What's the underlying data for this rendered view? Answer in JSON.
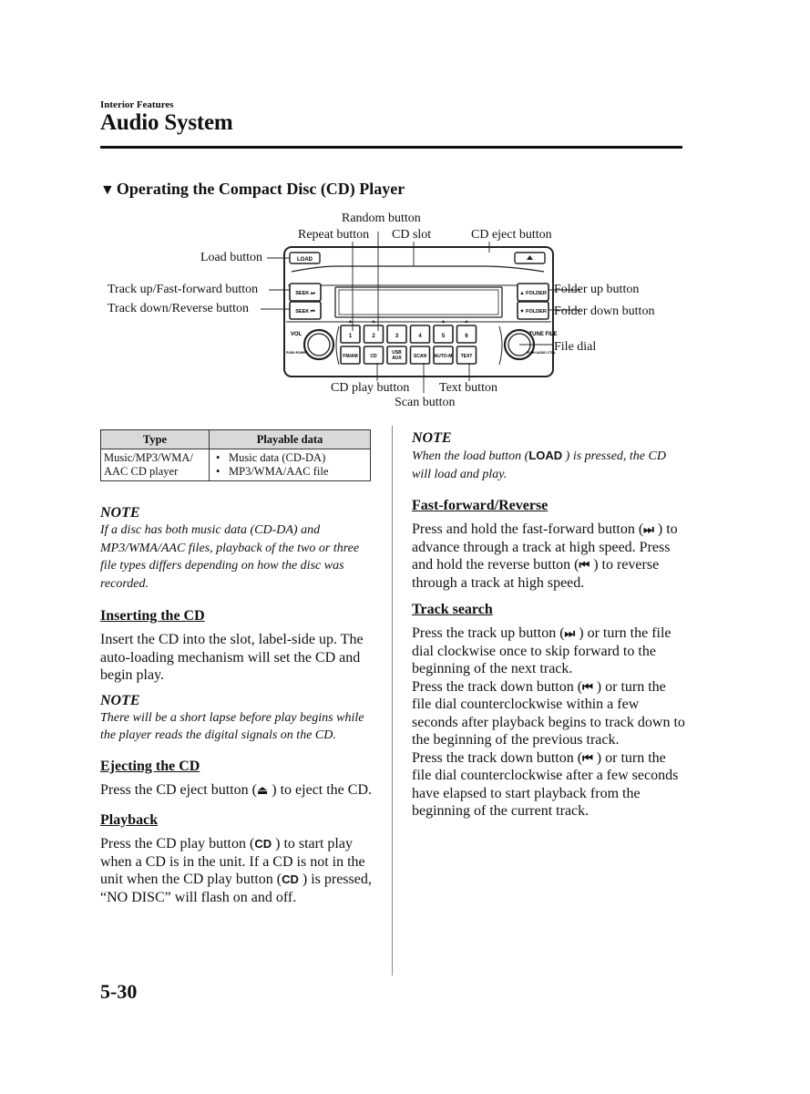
{
  "header": {
    "section_label": "Interior Features",
    "page_title": "Audio System"
  },
  "subsection": {
    "marker": "▼",
    "title": "Operating the Compact Disc (CD) Player"
  },
  "diagram": {
    "callouts": {
      "random": "Random button",
      "repeat": "Repeat button",
      "cd_slot": "CD slot",
      "cd_eject": "CD eject button",
      "load": "Load button",
      "track_up": "Track up/Fast-forward button",
      "track_down": "Track down/Reverse button",
      "folder_up": "Folder up button",
      "folder_down": "Folder down button",
      "file_dial": "File dial",
      "cd_play": "CD play button",
      "text": "Text button",
      "scan": "Scan button"
    },
    "panel_labels": {
      "load": "LOAD",
      "eject_icon": "▲",
      "seek_up": "SEEK ⏭",
      "seek_down": "SEEK ⏮",
      "folder_up": "▲ FOLDER",
      "folder_down": "▼ FOLDER",
      "vol": "VOL",
      "push_power": "PUSH POWER",
      "tune_file": "TUNE FILE",
      "push_audio_ctrl": "PUSH AUDIO CTRL",
      "presets": [
        "1",
        "2",
        "3",
        "4",
        "5",
        "6"
      ],
      "bottom_buttons": [
        "FM/AM",
        "CD",
        "USB AUX",
        "SCAN",
        "AUTO-M",
        "TEXT"
      ]
    }
  },
  "table": {
    "headers": [
      "Type",
      "Playable data"
    ],
    "rows": [
      {
        "type": "Music/MP3/WMA/ AAC CD player",
        "data": [
          "Music data (CD-DA)",
          "MP3/WMA/AAC file"
        ]
      }
    ]
  },
  "left_column": {
    "note1": {
      "heading": "NOTE",
      "text": "If a disc has both music data (CD-DA) and MP3/WMA/AAC files, playback of the two or three file types differs depending on how the disc was recorded."
    },
    "inserting": {
      "heading": "Inserting the CD",
      "text": "Insert the CD into the slot, label-side up. The auto-loading mechanism will set the CD and begin play."
    },
    "note2": {
      "heading": "NOTE",
      "text": "There will be a short lapse before play begins while the player reads the digital signals on the CD."
    },
    "ejecting": {
      "heading": "Ejecting the CD",
      "text_before": "Press the CD eject button (",
      "icon": "⏏",
      "text_after": " ) to eject the CD."
    },
    "playback": {
      "heading": "Playback",
      "t1": "Press the CD play button (",
      "icon1": "CD",
      "t2": " ) to start play when a CD is in the unit. If a CD is not in the unit when the CD play button (",
      "icon2": "CD",
      "t3": " ) is pressed, “NO DISC” will flash on and off."
    }
  },
  "right_column": {
    "note": {
      "heading": "NOTE",
      "t1": "When the load button (",
      "icon": "LOAD",
      "t2": " ) is pressed, the CD will load and play."
    },
    "ff_reverse": {
      "heading": "Fast-forward/Reverse",
      "t1": "Press and hold the fast-forward button (",
      "icon1": "⏭",
      "t2": " ) to advance through a track at high speed. Press and hold the reverse button (",
      "icon2": "⏮",
      "t3": " ) to reverse through a track at high speed."
    },
    "track_search": {
      "heading": "Track search",
      "p1_a": "Press the track up button (",
      "p1_icon": "⏭",
      "p1_b": " ) or turn the file dial clockwise once to skip forward to the beginning of the next track.",
      "p2_a": "Press the track down button (",
      "p2_icon": "⏮",
      "p2_b": " ) or turn the file dial counterclockwise within a few seconds after playback begins to track down to the beginning of the previous track.",
      "p3_a": "Press the track down button (",
      "p3_icon": "⏮",
      "p3_b": " ) or turn the file dial counterclockwise after a few seconds have elapsed to start playback from the beginning of the current track."
    }
  },
  "footer": {
    "page_number": "5-30"
  }
}
